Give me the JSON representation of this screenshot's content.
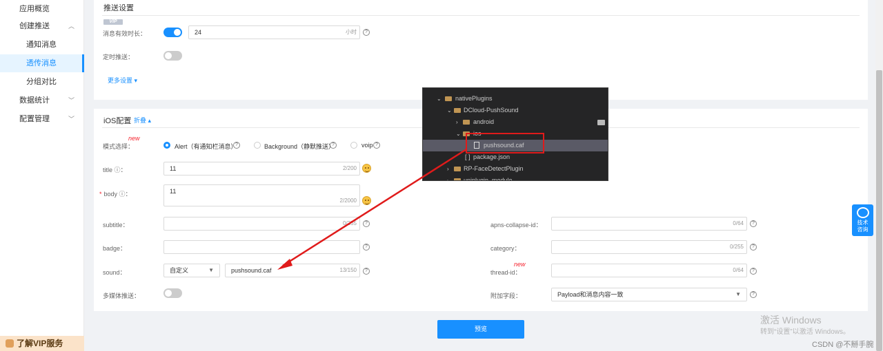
{
  "sidebar": {
    "items": [
      {
        "label": "应用概览"
      },
      {
        "label": "创建推送"
      },
      {
        "label": "通知消息"
      },
      {
        "label": "透传消息"
      },
      {
        "label": "分组对比"
      },
      {
        "label": "数据统计"
      },
      {
        "label": "配置管理"
      }
    ],
    "vip_label": "了解VIP服务"
  },
  "push_settings": {
    "title": "推送设置",
    "vip_badge": "VIP",
    "ttl_label": "消息有效时长：",
    "ttl_value": "24",
    "ttl_unit": "小时",
    "ttl_toggle_on": true,
    "scheduled_label": "定时推送：",
    "scheduled_toggle_on": false,
    "more_settings": "更多设置 ▾"
  },
  "ios": {
    "title": "iOS配置",
    "collapse": "折叠 ▴",
    "mode_label": "模式选择：",
    "mode_new": "new",
    "mode_options": [
      {
        "label": "Alert（有通知栏消息）",
        "selected": true
      },
      {
        "label": "Background（静默推送）",
        "selected": false
      },
      {
        "label": "voip",
        "selected": false
      }
    ],
    "title_label": "title ⓘ：",
    "title_value": "11",
    "title_count": "2/200",
    "body_label": "body ⓘ：",
    "body_value": "11",
    "body_count": "2/2000",
    "subtitle_label": "subtitle：",
    "subtitle_count": "0/255",
    "badge_label": "badge：",
    "sound_label": "sound：",
    "sound_select": "自定义",
    "sound_value": "pushsound.caf",
    "sound_count": "13/150",
    "media_label": "多媒体推送：",
    "media_toggle_on": false,
    "apns_label": "apns-collapse-id：",
    "apns_count": "0/64",
    "category_label": "category：",
    "category_count": "0/255",
    "thread_label": "thread-id：",
    "thread_new": "new",
    "thread_count": "0/64",
    "extra_label": "附加字段：",
    "extra_value": "Payload和消息内容一致"
  },
  "preview_button": "预览",
  "help_widget": {
    "line1": "技术",
    "line2": "咨询"
  },
  "file_tree": {
    "rows": [
      {
        "label": "nativePlugins"
      },
      {
        "label": "DCloud-PushSound"
      },
      {
        "label": "android"
      },
      {
        "label": "ios"
      },
      {
        "label": "pushsound.caf"
      },
      {
        "label": "package.json"
      },
      {
        "label": "RP-FaceDetectPlugin"
      },
      {
        "label": "uniplugin_module"
      }
    ]
  },
  "watermark": {
    "line1": "激活 Windows",
    "line2": "转到“设置”以激活 Windows。",
    "csdn": "CSDN @不掰手腕"
  },
  "colors": {
    "accent": "#1890ff",
    "annotation": "#e01b1b"
  }
}
